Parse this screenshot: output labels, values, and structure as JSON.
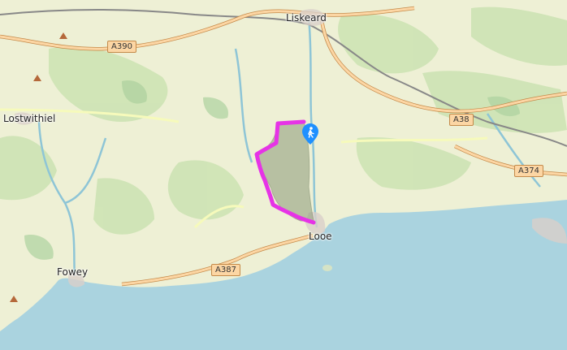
{
  "places": {
    "liskeard": "Liskeard",
    "lostwithiel": "Lostwithiel",
    "fowey": "Fowey",
    "looe": "Looe"
  },
  "roads": {
    "a390": "A390",
    "a38": "A38",
    "a374": "A374",
    "a387": "A387"
  },
  "colors": {
    "sea": "#aad3df",
    "land": "#eef0d5",
    "woods": "#add19e",
    "route": "#e633e6",
    "area_fill": "#8b9a7a",
    "marker": "#1e90ff",
    "primary_road": "#fcd6a4",
    "trunk_road": "#f9b29c"
  },
  "icons": {
    "marker": "hiker-pin-icon",
    "peaks": "peak-icon"
  }
}
